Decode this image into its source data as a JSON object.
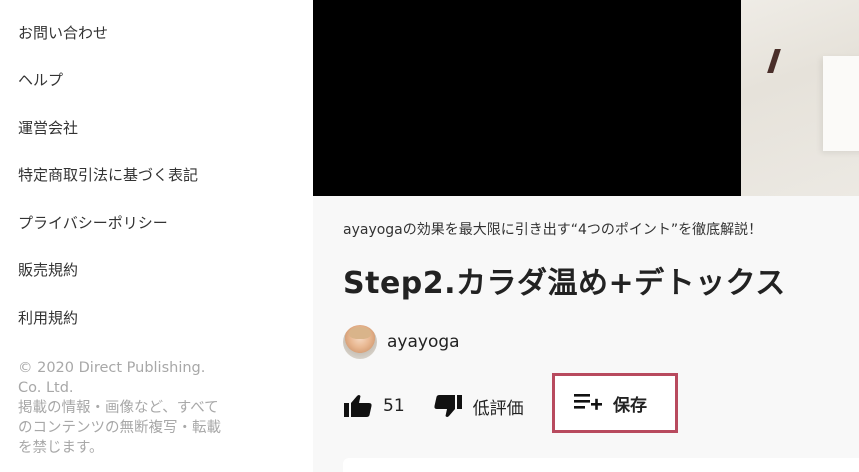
{
  "sidebar": {
    "links": [
      {
        "label": "お問い合わせ"
      },
      {
        "label": "ヘルプ"
      },
      {
        "label": "運営会社"
      },
      {
        "label": "特定商取引法に基づく表記"
      },
      {
        "label": "プライバシーポリシー"
      },
      {
        "label": "販売規約"
      },
      {
        "label": "利用規約"
      }
    ],
    "copyright_lines": [
      "© 2020 Direct Publishing.",
      "Co. Ltd.",
      "掲載の情報・画像など、すべて",
      "のコンテンツの無断複写・転載",
      "を禁じます。"
    ]
  },
  "video": {
    "subtitle": "ayayogaの効果を最大限に引き出す“4つのポイント”を徹底解説！",
    "title": "Step2.カラダ温め+デトックス",
    "channel_name": "ayayoga",
    "like_count": "51",
    "dislike_label": "低評価",
    "save_label": "保存"
  },
  "icons": {
    "like": "thumbs-up-icon",
    "dislike": "thumbs-down-icon",
    "save": "playlist-add-icon",
    "avatar": "channel-avatar"
  },
  "colors": {
    "save_highlight_border": "#b84a5e",
    "player_background": "#000000",
    "copyright_text": "#a8a8a8"
  }
}
